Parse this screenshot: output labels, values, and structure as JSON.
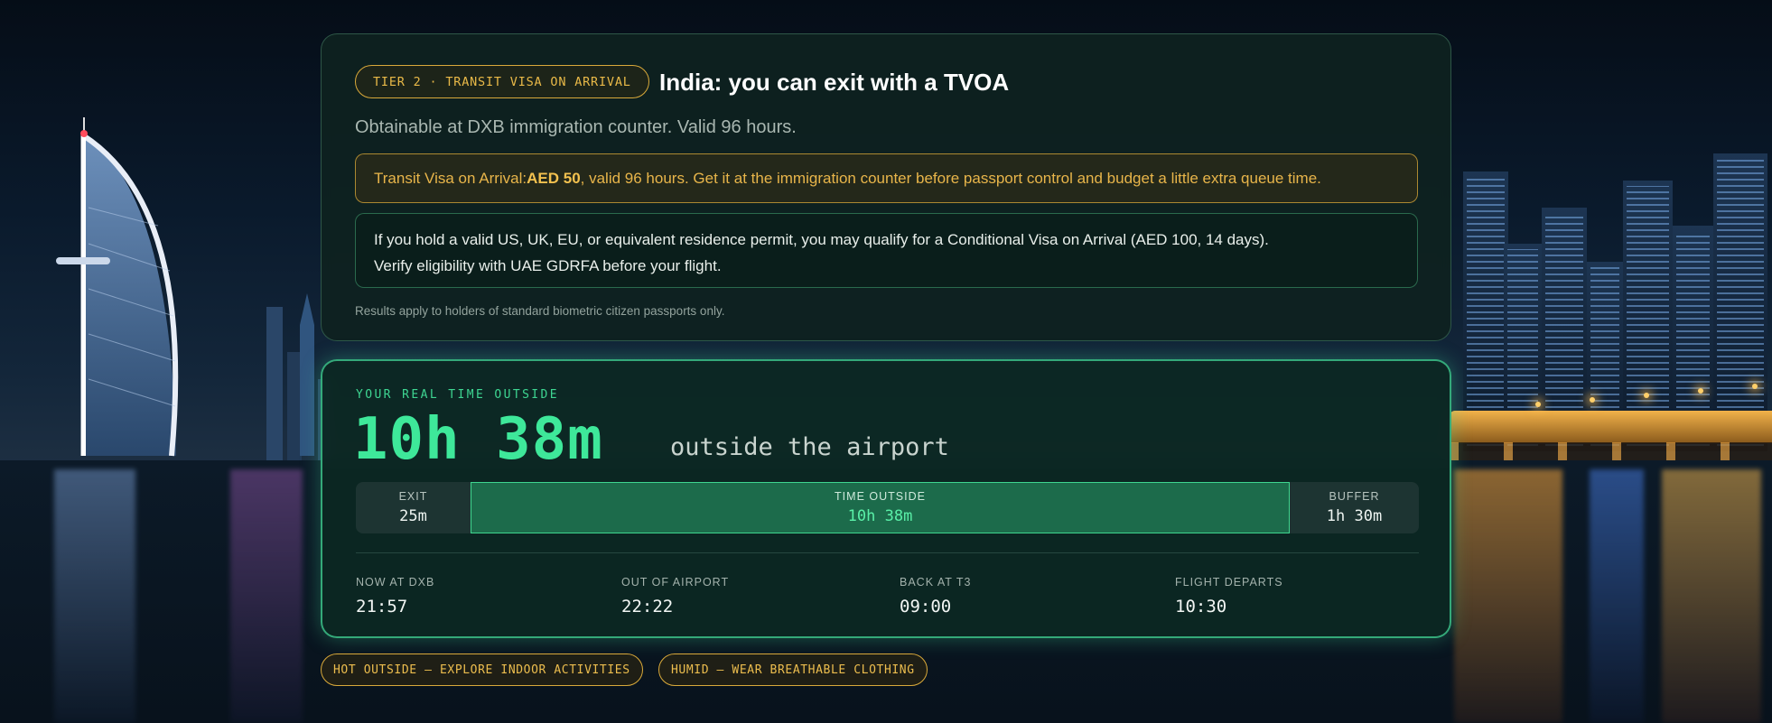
{
  "tier_card": {
    "badge": "TIER 2 · TRANSIT VISA ON ARRIVAL",
    "title": "India: you can exit with a TVOA",
    "subtitle": "Obtainable at DXB immigration counter. Valid 96 hours.",
    "visa_notice": {
      "prefix": "Transit Visa on Arrival: ",
      "fee": "AED 50",
      "suffix": ", valid 96 hours. Get it at the immigration counter before passport control and budget a little extra queue time."
    },
    "residence_notice": {
      "line1": "If you hold a valid US, UK, EU, or equivalent residence permit, you may qualify for a Conditional Visa on Arrival (AED 100, 14 days).",
      "line2": "Verify eligibility with UAE GDRFA before your flight."
    },
    "footnote": "Results apply to holders of standard biometric citizen passports only."
  },
  "time_card": {
    "label": "YOUR REAL TIME OUTSIDE",
    "value": "10h 38m",
    "suffix": "outside the airport",
    "timeline": {
      "exit": {
        "label": "EXIT",
        "value": "25m"
      },
      "outside": {
        "label": "TIME OUTSIDE",
        "value": "10h 38m"
      },
      "buffer": {
        "label": "BUFFER",
        "value": "1h 30m"
      }
    },
    "stats": [
      {
        "label": "NOW AT DXB",
        "value": "21:57"
      },
      {
        "label": "OUT OF AIRPORT",
        "value": "22:22"
      },
      {
        "label": "BACK AT T3",
        "value": "09:00"
      },
      {
        "label": "FLIGHT DEPARTS",
        "value": "10:30"
      }
    ]
  },
  "chips": [
    "HOT OUTSIDE – EXPLORE INDOOR ACTIVITIES",
    "HUMID – WEAR BREATHABLE CLOTHING"
  ],
  "colors": {
    "accent_green": "#3ee89a",
    "accent_amber": "#e9b948",
    "card_bg": "#0e2220"
  }
}
